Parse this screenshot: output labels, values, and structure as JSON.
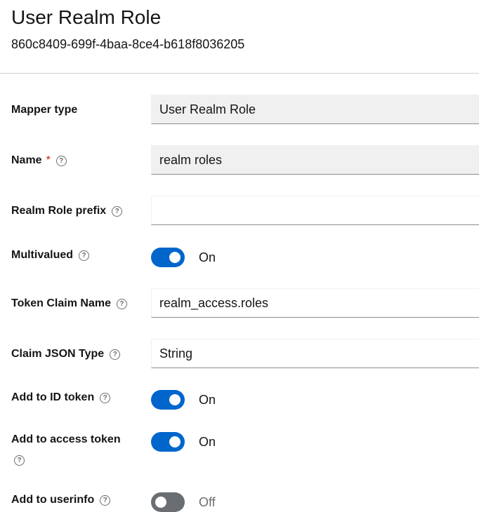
{
  "header": {
    "title": "User Realm Role",
    "subtitle": "860c8409-699f-4baa-8ce4-b618f8036205"
  },
  "form": {
    "mapper_type": {
      "label": "Mapper type",
      "value": "User Realm Role"
    },
    "name": {
      "label": "Name",
      "required_mark": "*",
      "value": "realm roles"
    },
    "realm_role_prefix": {
      "label": "Realm Role prefix",
      "value": ""
    },
    "multivalued": {
      "label": "Multivalued",
      "state_label": "On",
      "on": true
    },
    "token_claim_name": {
      "label": "Token Claim Name",
      "value": "realm_access.roles"
    },
    "claim_json_type": {
      "label": "Claim JSON Type",
      "value": "String"
    },
    "add_to_id_token": {
      "label": "Add to ID token",
      "state_label": "On",
      "on": true
    },
    "add_to_access_token": {
      "label": "Add to access token",
      "state_label": "On",
      "on": true
    },
    "add_to_userinfo": {
      "label": "Add to userinfo",
      "state_label": "Off",
      "on": false
    }
  },
  "icons": {
    "help": "help-circle-icon"
  },
  "colors": {
    "accent": "#0066cc",
    "required": "#c9190b",
    "off": "#6a6e73"
  }
}
